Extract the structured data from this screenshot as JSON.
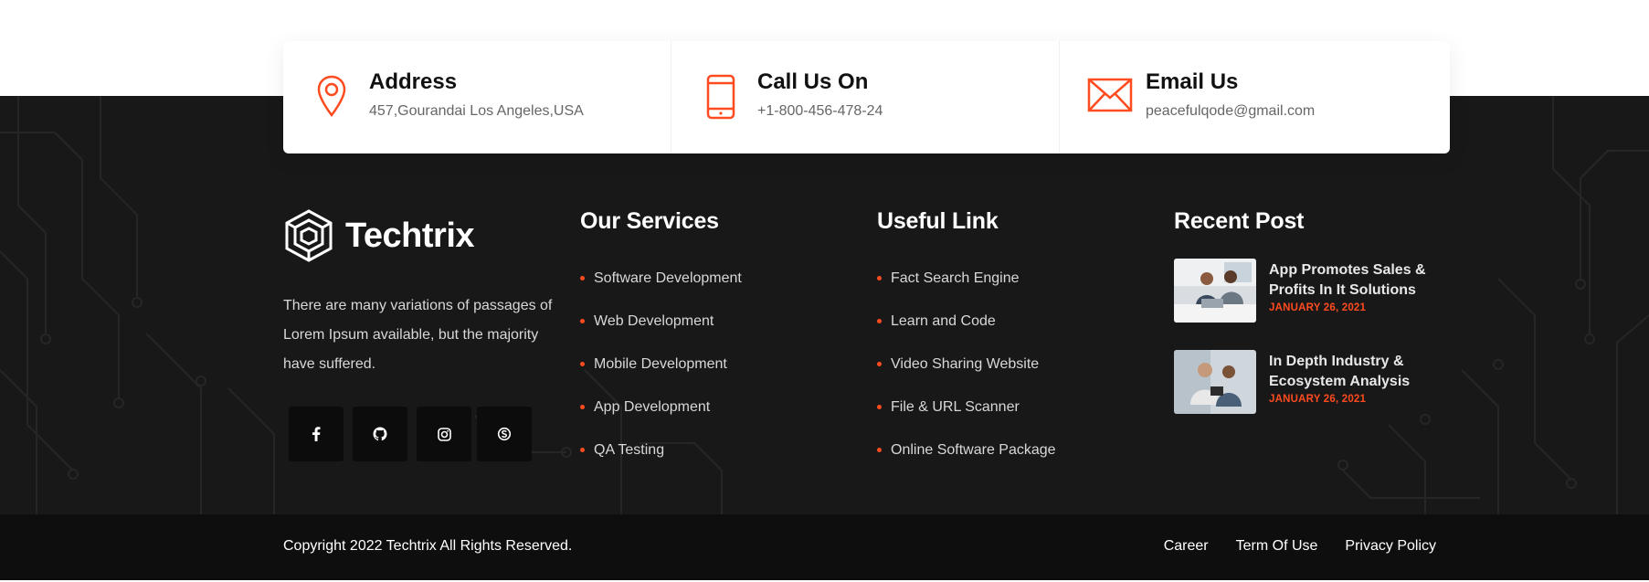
{
  "contacts": [
    {
      "title": "Address",
      "value": "457,Gourandai Los Angeles,USA",
      "icon": "map-pin-icon"
    },
    {
      "title": "Call Us On",
      "value": "+1-800-456-478-24",
      "icon": "phone-icon"
    },
    {
      "title": "Email Us",
      "value": "peacefulqode@gmail.com",
      "icon": "envelope-icon"
    }
  ],
  "brand": {
    "name": "Techtrix",
    "icon": "hexagon-logo-icon"
  },
  "about": "There are many variations of passages of Lorem Ipsum available, but the majority have suffered.",
  "socials": [
    "facebook-icon",
    "github-icon",
    "instagram-icon",
    "skype-icon"
  ],
  "services": {
    "title": "Our Services",
    "items": [
      "Software Development",
      "Web Development",
      "Mobile Development",
      "App Development",
      "QA Testing"
    ]
  },
  "useful": {
    "title": "Useful Link",
    "items": [
      "Fact Search Engine",
      "Learn and Code",
      "Video Sharing Website",
      "File & URL Scanner",
      "Online Software Package"
    ]
  },
  "recent": {
    "title": "Recent Post",
    "posts": [
      {
        "title": "App Promotes Sales & Profits In It Solutions",
        "date": "JANUARY 26, 2021"
      },
      {
        "title": "In Depth Industry & Ecosystem Analysis",
        "date": "JANUARY 26, 2021"
      }
    ]
  },
  "bottom": {
    "copyright": "Copyright 2022 Techtrix All Rights Reserved.",
    "links": [
      "Career",
      "Term Of Use",
      "Privacy Policy"
    ]
  },
  "colors": {
    "accent": "#ff4b1f",
    "footer_bg": "#181818",
    "bottom_bg": "#0e0e0e"
  }
}
